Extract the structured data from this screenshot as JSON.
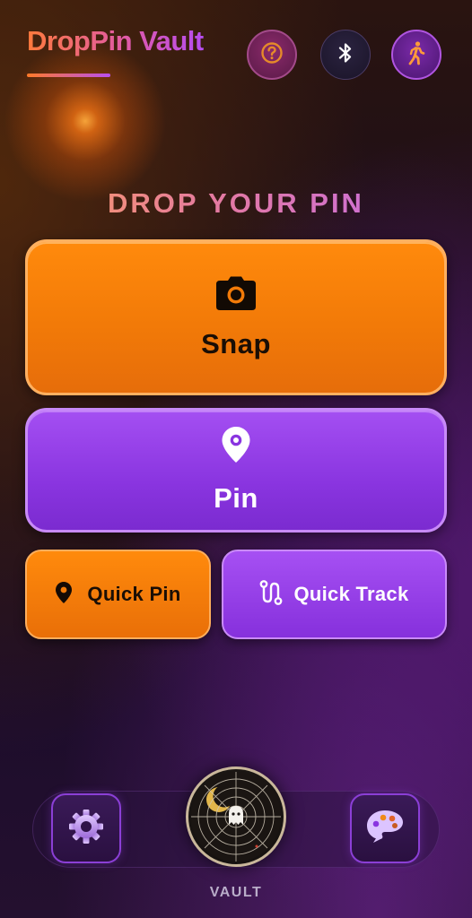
{
  "header": {
    "title": "DropPin Vault",
    "buttons": [
      {
        "icon": "help-icon"
      },
      {
        "icon": "bluetooth-icon"
      },
      {
        "icon": "walking-person-icon"
      }
    ]
  },
  "main": {
    "heading": "DROP YOUR PIN",
    "snap_button": {
      "label": "Snap",
      "icon": "camera-icon"
    },
    "pin_button": {
      "label": "Pin",
      "icon": "map-pin-icon"
    },
    "quick_pin_button": {
      "label": "Quick Pin",
      "icon": "map-pin-icon"
    },
    "quick_track_button": {
      "label": "Quick Track",
      "icon": "route-icon"
    }
  },
  "bottom_nav": {
    "settings_icon": "gear-icon",
    "vault_label": "VAULT",
    "vault_icon": "spiderweb-ghost-icon",
    "palette_icon": "palette-icon"
  },
  "colors": {
    "orange": "#f27a08",
    "purple": "#8a35e0",
    "background": "#150a1c"
  }
}
